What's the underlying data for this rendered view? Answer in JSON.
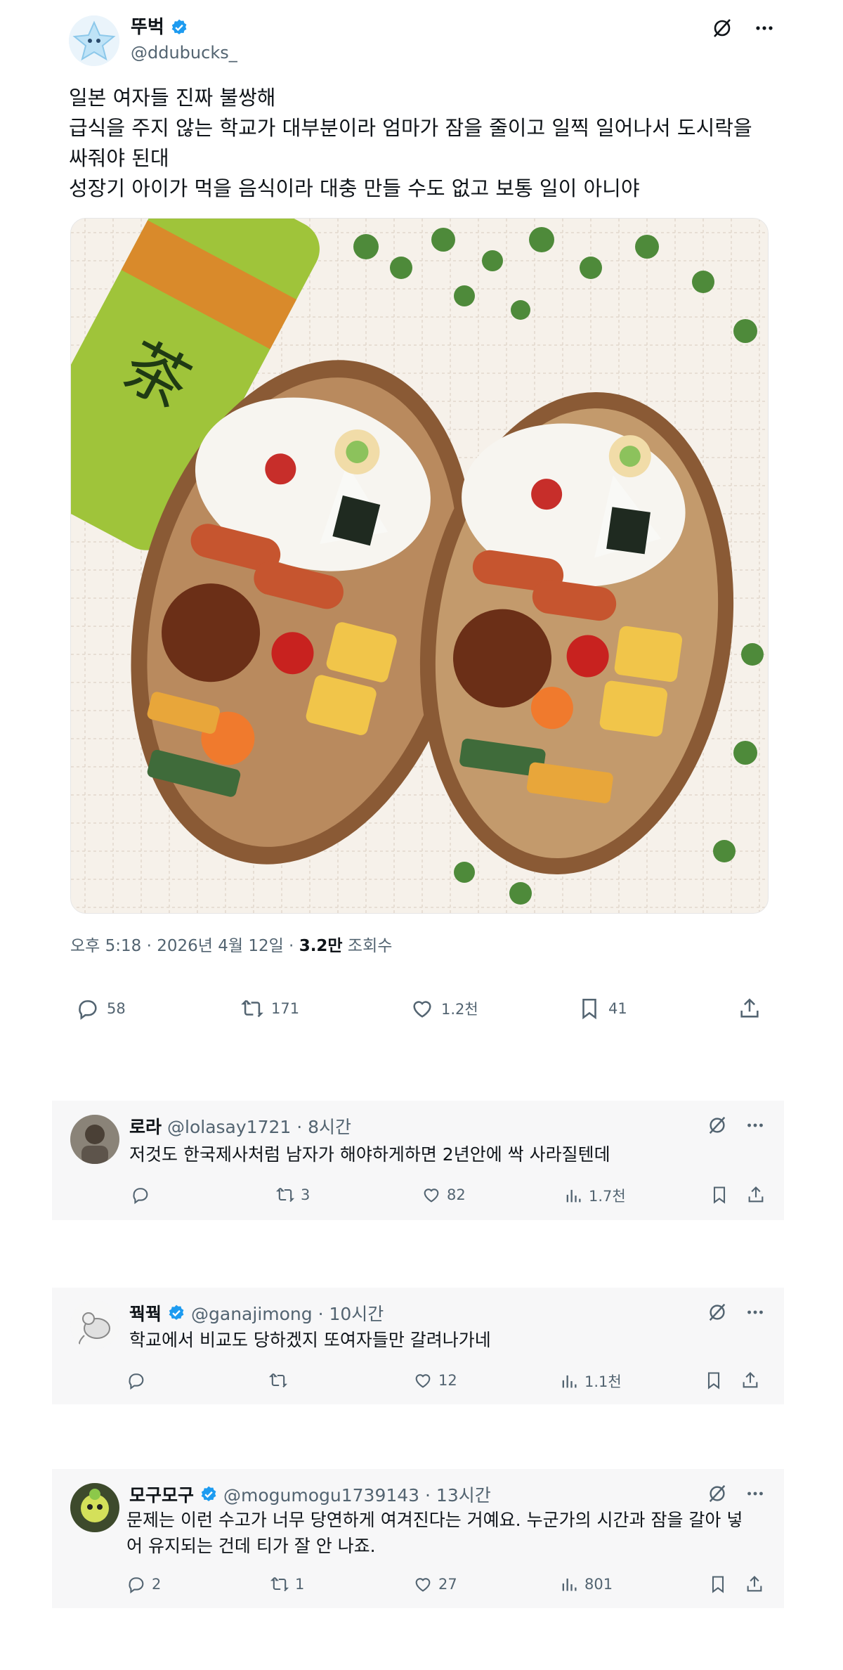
{
  "tweet": {
    "display_name": "뚜벅",
    "handle": "@ddubucks_",
    "verified": true,
    "text_lines": [
      "일본 여자들 진짜 불쌍해",
      "급식을 주지 않는 학교가 대부분이라 엄마가 잠을 줄이고 일찍 일어나서 도시락을",
      "싸줘야 된대",
      "성장기 아이가 먹을 음식이라 대충 만들 수도 없고 보통 일이 아니야"
    ],
    "time": "오후 5:18 · 2026년 4월 12일 · ",
    "views": "3.2만",
    "views_label": " 조회수",
    "replies": "58",
    "retweets": "171",
    "likes": "1.2천",
    "bookmarks": "41"
  },
  "replies": [
    {
      "display_name": "로라",
      "handle": "@lolasay1721 · 8시간",
      "verified": false,
      "text_lines": [
        "저것도 한국제사처럼 남자가 해야하게하면 2년안에 싹 사라질텐데"
      ],
      "replies": "",
      "retweets": "3",
      "likes": "82",
      "views": "1.7천"
    },
    {
      "display_name": "꿕꿕",
      "handle": "@ganajimong · 10시간",
      "verified": true,
      "text_lines": [
        "학교에서 비교도 당하겠지 또여자들만 갈려나가네"
      ],
      "replies": "",
      "retweets": "",
      "likes": "12",
      "views": "1.1천"
    },
    {
      "display_name": "모구모구",
      "handle": "@mogumogu1739143 · 13시간",
      "verified": true,
      "text_lines": [
        "문제는 이런 수고가 너무 당연하게 여겨진다는 거예요. 누군가의 시간과 잠을 갈아 넣",
        "어 유지되는 건데 티가 잘 안 나죠."
      ],
      "replies": "2",
      "retweets": "1",
      "likes": "27",
      "views": "801"
    }
  ],
  "colors": {
    "verified": "#1d9bf0",
    "text": "#0f1419",
    "muted": "#536471",
    "reply_bg": "#f7f7f8"
  },
  "icons": [
    "verified-badge-icon",
    "grok-icon",
    "more-icon",
    "reply-icon",
    "retweet-icon",
    "like-icon",
    "bookmark-icon",
    "share-icon",
    "views-icon"
  ]
}
